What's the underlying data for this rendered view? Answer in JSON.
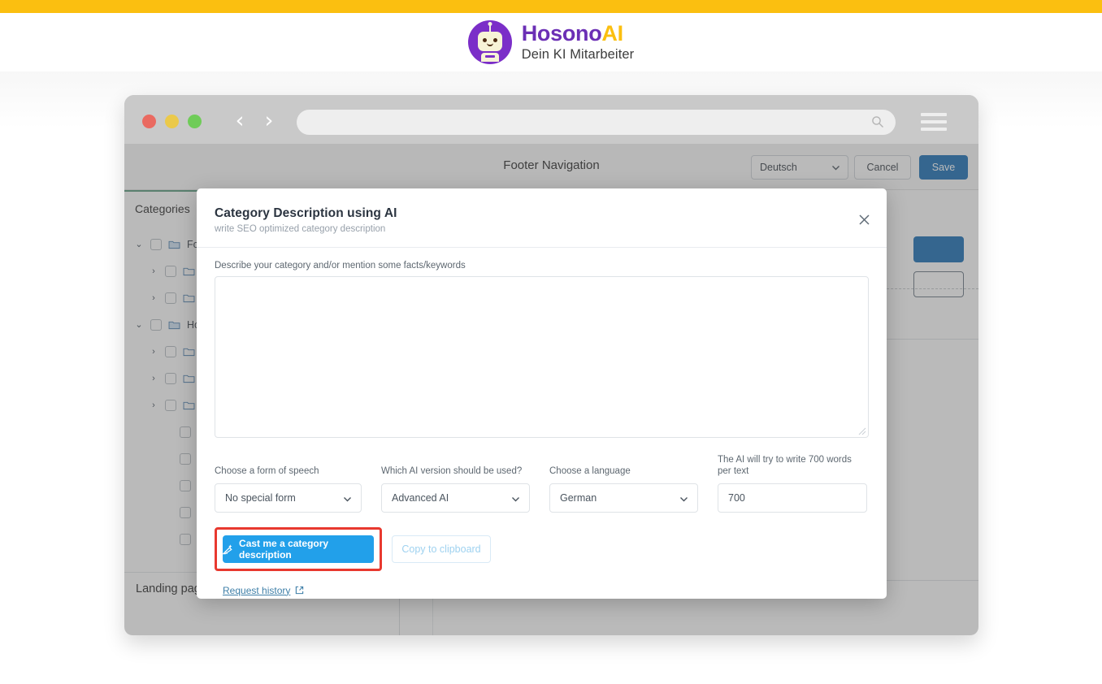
{
  "site": {
    "top_bar_color": "#fbbf10",
    "logo": {
      "name_part1": "Hosono",
      "name_part2": "AI",
      "tagline": "Dein KI Mitarbeiter",
      "mark_color": "#7b2ec8",
      "accent_color": "#fbbf10"
    }
  },
  "browser": {
    "traffic_lights": [
      "close-red",
      "minimize-yellow",
      "maximize-green"
    ],
    "back_icon": "‹",
    "forward_icon": "›",
    "url_value": "",
    "search_icon": "search-icon",
    "menu_icon": "hamburger-icon"
  },
  "app": {
    "toolbar": {
      "title": "Footer Navigation",
      "language_select": "Deutsch",
      "cancel_label": "Cancel",
      "save_label": "Save",
      "save_color": "#1a6fb5"
    },
    "sidebar": {
      "heading": "Categories",
      "tree": [
        {
          "level": 0,
          "caret": "⌄",
          "icon": "folder-open-icon",
          "label": "Foo"
        },
        {
          "level": 1,
          "caret": "›",
          "icon": "folder-icon",
          "label": ""
        },
        {
          "level": 1,
          "caret": "›",
          "icon": "folder-icon",
          "label": ""
        },
        {
          "level": 0,
          "caret": "⌄",
          "icon": "folder-open-icon",
          "label": "Hos"
        },
        {
          "level": 1,
          "caret": "›",
          "icon": "folder-icon",
          "label": ""
        },
        {
          "level": 1,
          "caret": "›",
          "icon": "folder-icon",
          "label": ""
        },
        {
          "level": 1,
          "caret": "›",
          "icon": "folder-icon",
          "label": ""
        },
        {
          "level": 2,
          "caret": "",
          "icon": "circle-icon",
          "label": ""
        },
        {
          "level": 2,
          "caret": "",
          "icon": "circle-icon",
          "label": ""
        },
        {
          "level": 2,
          "caret": "",
          "icon": "circle-icon",
          "label": ""
        },
        {
          "level": 2,
          "caret": "",
          "icon": "circle-icon",
          "label": ""
        },
        {
          "level": 2,
          "caret": "",
          "icon": "circle-icon",
          "label": ""
        }
      ],
      "footer_item": "Landing pages",
      "footer_chevron": "›"
    }
  },
  "modal": {
    "title": "Category Description using AI",
    "subtitle": "write SEO optimized category description",
    "close_icon": "close-icon",
    "textarea": {
      "label": "Describe your category and/or mention some facts/keywords",
      "value": "",
      "placeholder": ""
    },
    "controls": [
      {
        "label": "Choose a form of speech",
        "value": "No special form",
        "type": "select"
      },
      {
        "label": "Which AI version should be used?",
        "value": "Advanced AI",
        "type": "select"
      },
      {
        "label": "Choose a language",
        "value": "German",
        "type": "select"
      },
      {
        "label": "The AI will try to write 700 words per text",
        "value": "700",
        "type": "input"
      }
    ],
    "primary_button": {
      "label": "Cast me a category description",
      "icon": "magic-wand-icon",
      "color": "#22a0ea",
      "highlight_color": "#e8392f"
    },
    "secondary_button": {
      "label": "Copy to clipboard",
      "disabled": true
    },
    "link": {
      "label": "Request history",
      "icon": "external-link-icon"
    }
  }
}
